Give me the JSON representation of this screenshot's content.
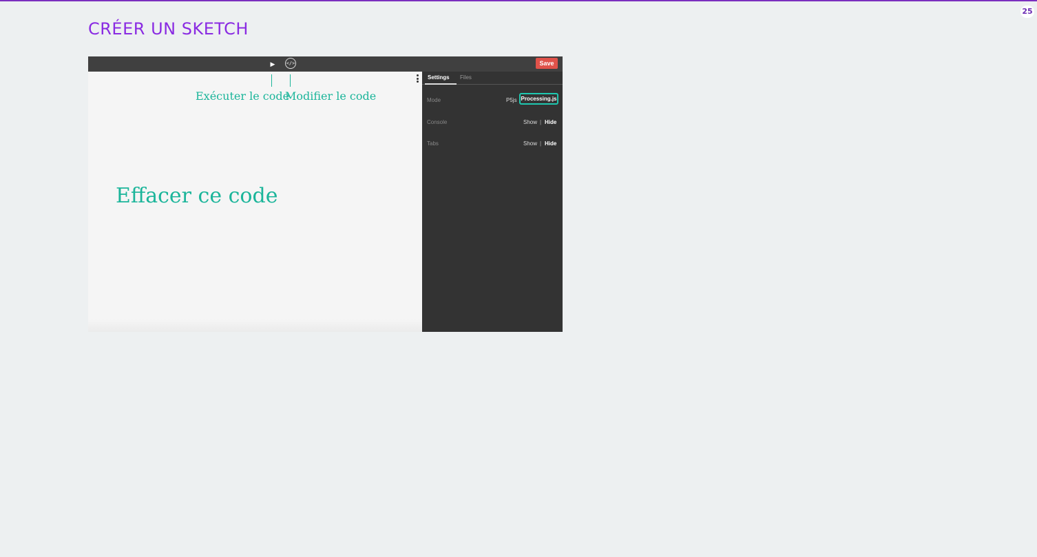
{
  "slide": {
    "title": "CRÉER UN SKETCH",
    "page_number": "25"
  },
  "app": {
    "toolbar": {
      "play_glyph": "▶",
      "code_glyph": "</>",
      "save_label": "Save"
    },
    "editor": {
      "callouts": {
        "run": "Exécuter le code",
        "edit": "Modifier le code"
      },
      "clear_label": "Effacer ce code"
    },
    "settings": {
      "tabs": [
        {
          "label": "Settings",
          "active": true
        },
        {
          "label": "Files",
          "active": false
        }
      ],
      "rows": [
        {
          "label": "Mode",
          "options": [
            "P5js",
            "Processing.js"
          ],
          "selected": "Processing.js"
        },
        {
          "label": "Console",
          "options": [
            "Show",
            "Hide"
          ],
          "separator": "|",
          "selected": "Hide"
        },
        {
          "label": "Tabs",
          "options": [
            "Show",
            "Hide"
          ],
          "separator": "|",
          "selected": "Hide"
        }
      ]
    }
  },
  "colors": {
    "accent_purple": "#8a2be2",
    "callout_teal": "#1bb59a",
    "save_red": "#e0524a",
    "highlight_teal": "#1fc8b0"
  },
  "icons": [
    "play-icon",
    "code-icon",
    "kebab-menu-icon"
  ]
}
